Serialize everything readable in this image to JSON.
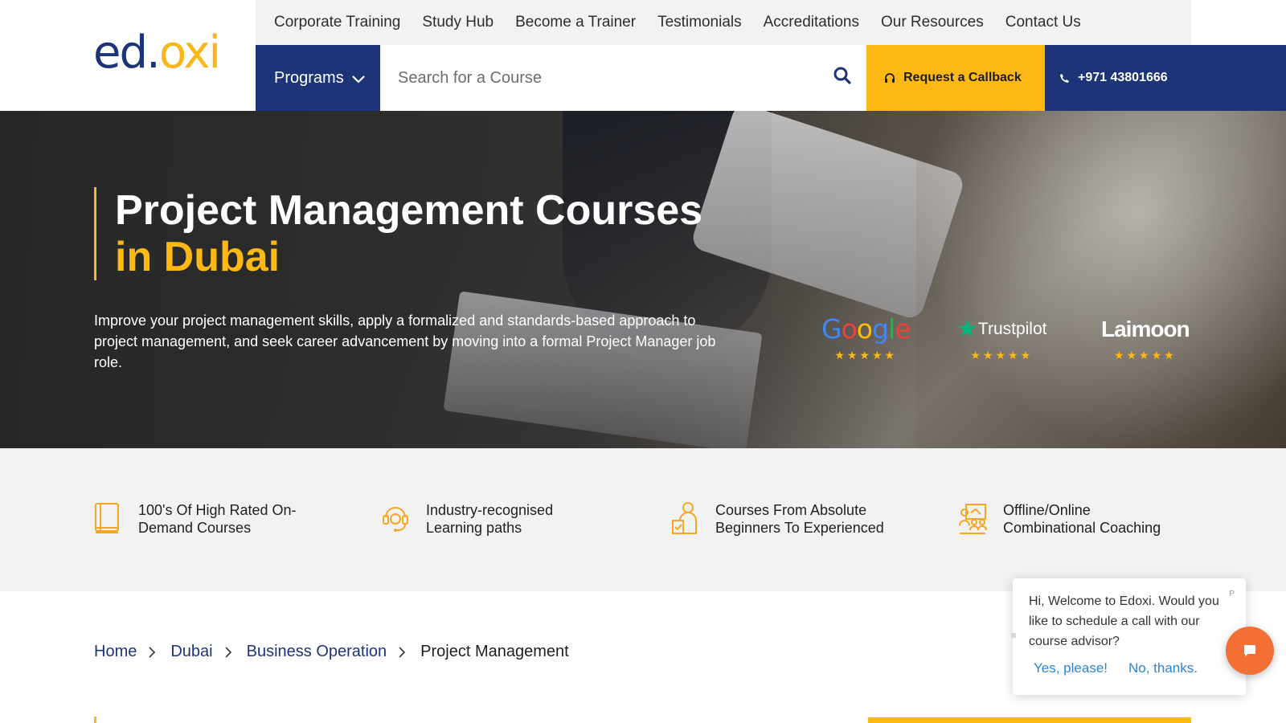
{
  "logo": {
    "part1": "ed",
    "dot": ".",
    "part2": "oxi"
  },
  "topnav": {
    "items": [
      "Corporate Training",
      "Study Hub",
      "Become a Trainer",
      "Testimonials",
      "Accreditations",
      "Our Resources",
      "Contact Us"
    ]
  },
  "navbar": {
    "programs_label": "Programs",
    "search_placeholder": "Search for a Course",
    "callback_label": "Request a Callback",
    "phone": "+971 43801666"
  },
  "hero": {
    "title_line1": "Project Management Courses",
    "title_line2": "in Dubai",
    "description": "Improve your project management skills, apply a formalized and standards-based approach to project management, and seek career advancement by moving into a formal Project Manager job role."
  },
  "ratings": [
    {
      "brand": "Google",
      "stars": "★★★★★"
    },
    {
      "brand": "Trustpilot",
      "stars": "★★★★★"
    },
    {
      "brand": "Laimoon",
      "stars": "★★★★★"
    }
  ],
  "features": [
    {
      "line1": "100's Of High Rated On-",
      "line2": "Demand Courses",
      "icon": "book-icon"
    },
    {
      "line1": "Industry-recognised",
      "line2": "Learning paths",
      "icon": "support-headset-icon"
    },
    {
      "line1": "Courses From Absolute",
      "line2": "Beginners To Experienced",
      "icon": "person-check-icon"
    },
    {
      "line1": "Offline/Online",
      "line2": "Combinational Coaching",
      "icon": "classroom-icon"
    }
  ],
  "breadcrumb": {
    "items": [
      "Home",
      "Dubai",
      "Business Operation"
    ],
    "current": "Project Management"
  },
  "chat": {
    "message": "Hi, Welcome to Edoxi. Would you like to schedule a call with our course advisor?",
    "yes_label": "Yes, please!",
    "no_label": "No, thanks.",
    "close_label": "P"
  },
  "colors": {
    "navy": "#1d3577",
    "yellow": "#fdb813",
    "chat_orange": "#f26f36",
    "link_blue": "#2a86d8"
  }
}
